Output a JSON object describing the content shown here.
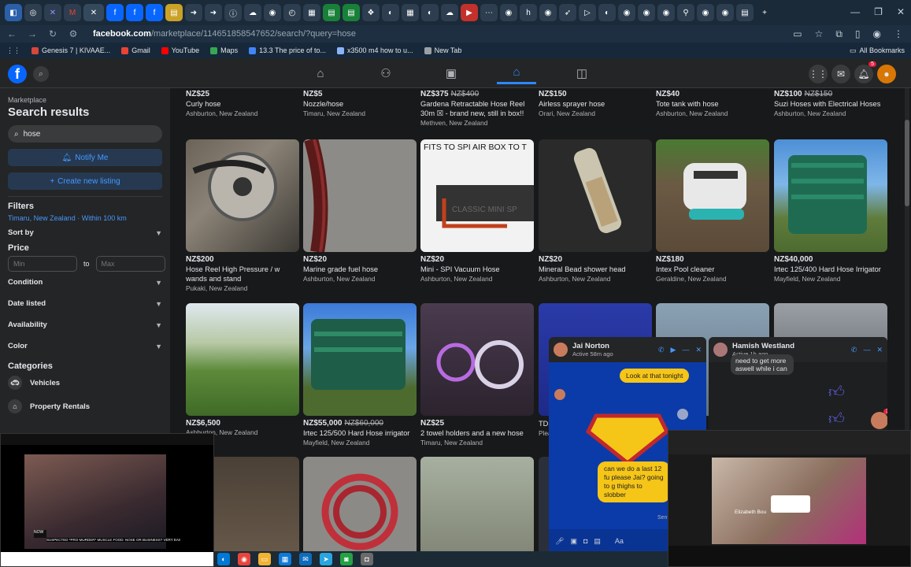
{
  "browser": {
    "url_domain": "facebook.com",
    "url_path": "/marketplace/114651858547652/search/?query=hose",
    "bookmarks": [
      {
        "label": "Genesis 7 | KIVAAE...",
        "color": "#d9463b"
      },
      {
        "label": "Gmail",
        "color": "#ea4335"
      },
      {
        "label": "YouTube",
        "color": "#ff0000"
      },
      {
        "label": "Maps",
        "color": "#34a853"
      },
      {
        "label": "13.3 The price of to...",
        "color": "#4285f4"
      },
      {
        "label": "x3500 m4 how to u...",
        "color": "#8ab4f8"
      },
      {
        "label": "New Tab",
        "color": "#9aa0a6"
      }
    ],
    "all_bookmarks": "All Bookmarks"
  },
  "header": {
    "logo": "f",
    "notif_count": "5",
    "avatar_badge": "3"
  },
  "sidebar": {
    "crumb": "Marketplace",
    "title": "Search results",
    "search_value": "hose",
    "notify_label": "Notify Me",
    "create_label": "Create new listing",
    "filters_label": "Filters",
    "location": "Timaru, New Zealand · Within 100 km",
    "sort_label": "Sort by",
    "price_label": "Price",
    "price_min": "Min",
    "price_to": "to",
    "price_max": "Max",
    "condition": "Condition",
    "date_listed": "Date listed",
    "availability": "Availability",
    "color": "Color",
    "categories_label": "Categories",
    "cat_vehicles": "Vehicles",
    "cat_property": "Property Rentals"
  },
  "listings_row0": [
    {
      "price": "NZ$25",
      "old": "",
      "title": "Curly hose",
      "loc": "Ashburton, New Zealand"
    },
    {
      "price": "NZ$5",
      "old": "",
      "title": "Nozzle/hose",
      "loc": "Timaru, New Zealand"
    },
    {
      "price": "NZ$375",
      "old": "NZ$400",
      "title": "Gardena Retractable Hose Reel 30m ☒ - brand new, still in box!!",
      "loc": "Methven, New Zealand"
    },
    {
      "price": "NZ$150",
      "old": "",
      "title": "Airless sprayer hose",
      "loc": "Orari, New Zealand"
    },
    {
      "price": "NZ$40",
      "old": "",
      "title": "Tote tank with hose",
      "loc": "Ashburton, New Zealand"
    },
    {
      "price": "NZ$100",
      "old": "NZ$150",
      "title": "Suzi Hoses with Electrical Hoses",
      "loc": "Ashburton, New Zealand"
    }
  ],
  "listings_row1": [
    {
      "price": "NZ$200",
      "old": "",
      "title": "Hose Reel High Pressure / w wands and stand",
      "loc": "Pukaki, New Zealand"
    },
    {
      "price": "NZ$20",
      "old": "",
      "title": "Marine grade fuel hose",
      "loc": "Ashburton, New Zealand"
    },
    {
      "price": "NZ$20",
      "old": "",
      "title": "Mini - SPI Vacuum Hose",
      "loc": "Ashburton, New Zealand"
    },
    {
      "price": "NZ$20",
      "old": "",
      "title": "Mineral Bead shower head",
      "loc": "Ashburton, New Zealand"
    },
    {
      "price": "NZ$180",
      "old": "",
      "title": "Intex Pool cleaner",
      "loc": "Geraldine, New Zealand"
    },
    {
      "price": "NZ$40,000",
      "old": "",
      "title": "Irtec 125/400 Hard Hose Irrigator",
      "loc": "Mayfield, New Zealand"
    }
  ],
  "listings_row2": [
    {
      "price": "NZ$6,500",
      "old": "",
      "title": "",
      "loc": "Ashburton, New Zealand"
    },
    {
      "price": "NZ$55,000",
      "old": "NZ$60,000",
      "title": "Irtec 125/500 Hard Hose irrigator",
      "loc": "Mayfield, New Zealand"
    },
    {
      "price": "NZ$25",
      "old": "",
      "title": "2 towel holders and a new hose",
      "loc": "Timaru, New Zealand"
    },
    {
      "price": "",
      "old": "",
      "title": "TDS",
      "loc": "Plea"
    }
  ],
  "img_text_spi": "FITS TO SPI AIR BOX TO T",
  "img_text_classic": "CLASSIC MINI SP",
  "chat1": {
    "name": "Jai Norton",
    "status": "Active 58m ago",
    "msg1": "Look at that tonight",
    "msg2": "can we do a last 12 fu please Jai? going to g thighs to slobber",
    "sent": "Sent",
    "input": "Aa"
  },
  "chat2": {
    "name": "Hamish Westland",
    "status": "Active 1h ago",
    "msg": "need to get more aswell while i can"
  },
  "video_left": {
    "caption": "SUSPECTED *PRO-MURDER* MUSCLE FOOD: NOSE OR BUSINESS? VERY EASY AND TO HOLD"
  },
  "video_right": {
    "name": "Elizabeth Bou"
  }
}
